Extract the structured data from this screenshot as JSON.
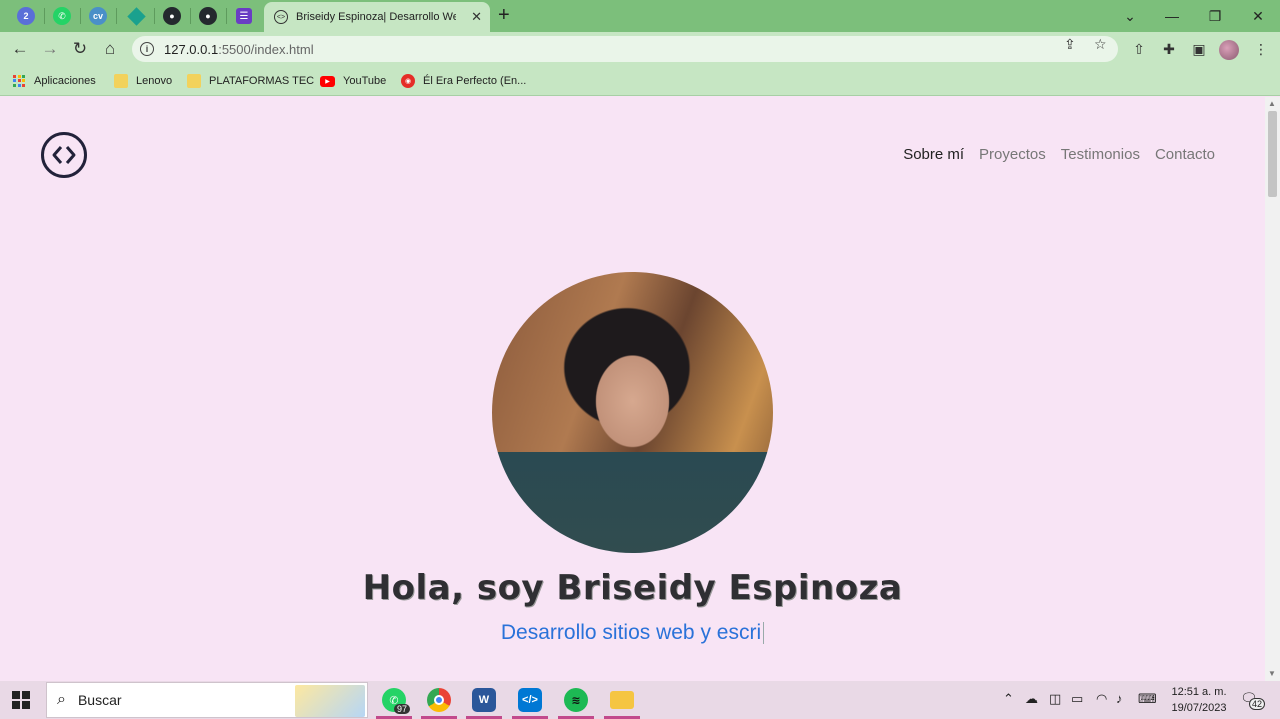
{
  "browser": {
    "active_tab": {
      "title": "Briseidy Espinoza| Desarrollo Web",
      "close": "✕"
    },
    "new_tab": "+",
    "window_controls": [
      "⌄",
      "—",
      "❐",
      "✕"
    ],
    "pinned_badge": "2",
    "pinned_cv_label": "cv",
    "url": {
      "host": "127.0.0.1",
      "path": ":5500/index.html"
    },
    "bookmarks": [
      {
        "label": "Aplicaciones",
        "icon": "apps-grid-icon"
      },
      {
        "label": "Lenovo",
        "icon": "folder-icon"
      },
      {
        "label": "PLATAFORMAS TEC",
        "icon": "folder-icon"
      },
      {
        "label": "YouTube",
        "icon": "youtube-icon"
      },
      {
        "label": "Él Era Perfecto (En...",
        "icon": "red-circle-icon"
      }
    ]
  },
  "page": {
    "nav": [
      {
        "label": "Sobre mí",
        "active": true
      },
      {
        "label": "Proyectos"
      },
      {
        "label": "Testimonios"
      },
      {
        "label": "Contacto"
      }
    ],
    "hero": {
      "title": "Hola, soy Briseidy Espinoza",
      "subtitle": "Desarrollo sitios web y escri"
    }
  },
  "taskbar": {
    "search_placeholder": "Buscar",
    "whatsapp_badge": "97",
    "clock_time": "12:51 a. m.",
    "clock_date": "19/07/2023",
    "notifications": "42"
  },
  "colors": {
    "page_bg": "#f8e4f5",
    "chrome_green": "#7cbf7b",
    "toolbar_green": "#c6e6c3",
    "subtitle_blue": "#2a72d9"
  }
}
